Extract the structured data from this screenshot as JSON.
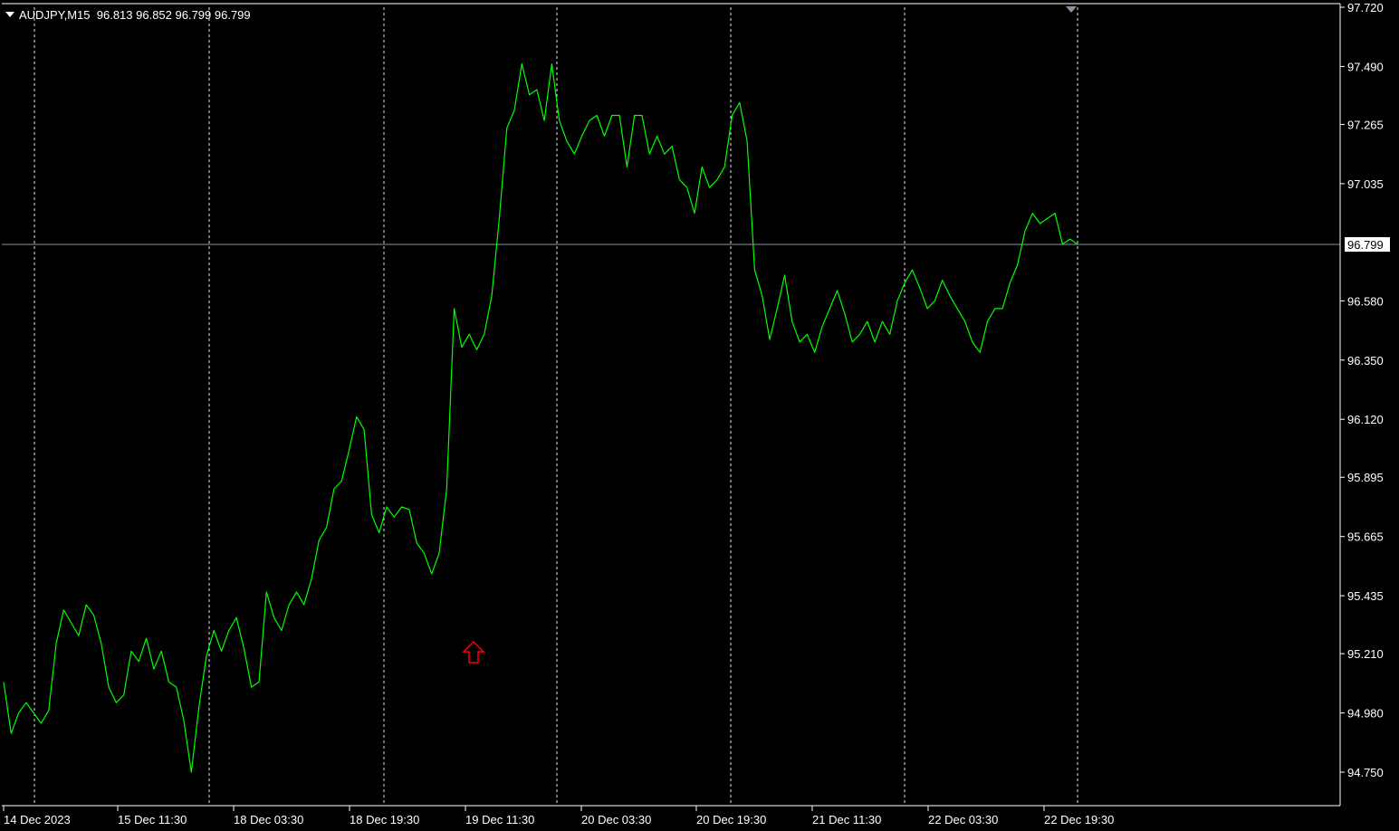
{
  "header": {
    "symbol": "AUDJPY,M15",
    "ohlc": "96.813 96.852 96.799 96.799"
  },
  "colors": {
    "background": "#000000",
    "price_line": "#00ff00",
    "grid": "#ffffff",
    "current_price_line": "#8a96a8",
    "axis_text": "#ffffff",
    "arrow": "#ff0000"
  },
  "chart_data": {
    "type": "line",
    "series": [
      {
        "values": [
          95.1,
          94.9,
          94.98,
          95.02,
          94.98,
          94.94,
          94.99,
          95.25,
          95.38,
          95.33,
          95.28,
          95.4,
          95.36,
          95.25,
          95.08,
          95.02,
          95.05,
          95.22,
          95.18,
          95.27,
          95.15,
          95.22,
          95.1,
          95.08,
          94.95,
          94.75,
          95.0,
          95.2,
          95.3,
          95.22,
          95.3,
          95.35,
          95.23,
          95.08,
          95.1,
          95.45,
          95.35,
          95.3,
          95.4,
          95.45,
          95.4,
          95.5,
          95.65,
          95.7,
          95.85,
          95.88,
          96.0,
          96.13,
          96.08,
          95.75,
          95.68,
          95.78,
          95.74,
          95.78,
          95.77,
          95.64,
          95.6,
          95.52,
          95.6,
          95.85,
          96.55,
          96.4,
          96.45,
          96.39,
          96.45,
          96.6,
          96.9,
          97.25,
          97.32,
          97.5,
          97.38,
          97.4,
          97.28,
          97.5,
          97.28,
          97.2,
          97.15,
          97.22,
          97.28,
          97.3,
          97.22,
          97.3,
          97.3,
          97.1,
          97.3,
          97.3,
          97.15,
          97.22,
          97.15,
          97.18,
          97.05,
          97.02,
          96.92,
          97.1,
          97.02,
          97.05,
          97.1,
          97.3,
          97.35,
          97.2,
          96.7,
          96.6,
          96.43,
          96.55,
          96.68,
          96.5,
          96.42,
          96.45,
          96.38,
          96.48,
          96.55,
          96.62,
          96.53,
          96.42,
          96.45,
          96.5,
          96.42,
          96.5,
          96.45,
          96.58,
          96.65,
          96.7,
          96.63,
          96.55,
          96.58,
          96.66,
          96.6,
          96.55,
          96.5,
          96.42,
          96.38,
          96.5,
          96.55,
          96.55,
          96.65,
          96.72,
          96.85,
          96.92,
          96.88,
          96.9,
          96.92,
          96.8,
          96.82,
          96.799
        ],
        "color": "#00ff00"
      }
    ],
    "x_labels": [
      "14 Dec 2023",
      "15 Dec 11:30",
      "18 Dec 03:30",
      "18 Dec 19:30",
      "19 Dec 11:30",
      "20 Dec 03:30",
      "20 Dec 19:30",
      "21 Dec 11:30",
      "22 Dec 03:30",
      "22 Dec 19:30"
    ],
    "y_ticks": [
      "97.720",
      "97.490",
      "97.265",
      "97.035",
      "96.799",
      "96.580",
      "96.350",
      "96.120",
      "95.895",
      "95.665",
      "95.435",
      "95.210",
      "94.980",
      "94.750"
    ],
    "ylim": [
      94.62,
      97.72
    ],
    "current_price": 96.799,
    "current_price_label": "96.799",
    "grid": true,
    "annotation": "red-up-arrow"
  }
}
